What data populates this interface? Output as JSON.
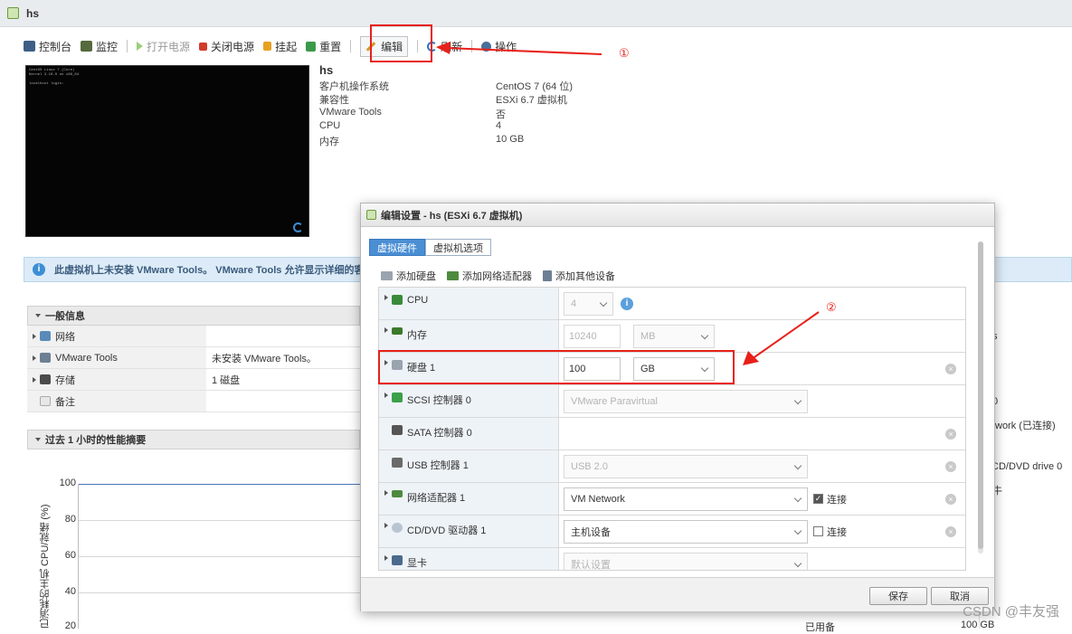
{
  "window": {
    "title": "hs"
  },
  "toolbar": {
    "console": "控制台",
    "monitor": "监控",
    "power_on": "打开电源",
    "power_off": "关闭电源",
    "suspend": "挂起",
    "reset": "重置",
    "edit": "编辑",
    "refresh": "刷新",
    "actions": "操作"
  },
  "annotations": {
    "num1": "①",
    "num2": "②"
  },
  "vm": {
    "name": "hs",
    "rows": [
      {
        "k": "客户机操作系统",
        "v": "CentOS 7 (64 位)"
      },
      {
        "k": "兼容性",
        "v": "ESXi 6.7 虚拟机"
      },
      {
        "k": "VMware Tools",
        "v": "否"
      },
      {
        "k": "CPU",
        "v": "4"
      },
      {
        "k": "内存",
        "v": "10 GB"
      }
    ]
  },
  "banner": {
    "text": "此虚拟机上未安装 VMware Tools。 VMware Tools 允许显示详细的客户"
  },
  "general": {
    "title": "一般信息",
    "rows": [
      {
        "k": "网络",
        "v": ""
      },
      {
        "k": "VMware Tools",
        "v": "未安装 VMware Tools。"
      },
      {
        "k": "存储",
        "v": "1 磁盘"
      },
      {
        "k": "备注",
        "v": ""
      }
    ]
  },
  "perf": {
    "title": "过去 1 小时的性能摘要",
    "ylabel": "已消耗的主机 CPU/就绪 (%)",
    "ticks": [
      "100",
      "80",
      "60",
      "40",
      "20"
    ]
  },
  "right_bits": [
    "s",
    "0",
    "work (已连接)",
    "CD/DVD drive 0",
    "牛",
    "已用备",
    "100 GB"
  ],
  "dialog": {
    "title": "编辑设置 - hs (ESXi 6.7 虚拟机)",
    "tabs": [
      "虚拟硬件",
      "虚拟机选项"
    ],
    "add": {
      "disk": "添加硬盘",
      "nic": "添加网络适配器",
      "other": "添加其他设备"
    },
    "hw": {
      "cpu": {
        "label": "CPU",
        "value": "4"
      },
      "mem": {
        "label": "内存",
        "value": "10240",
        "unit": "MB"
      },
      "disk": {
        "label": "硬盘 1",
        "value": "100",
        "unit": "GB"
      },
      "scsi": {
        "label": "SCSI 控制器 0",
        "value": "VMware Paravirtual"
      },
      "sata": {
        "label": "SATA 控制器 0"
      },
      "usb": {
        "label": "USB 控制器 1",
        "value": "USB 2.0"
      },
      "net": {
        "label": "网络适配器 1",
        "value": "VM Network",
        "connect": "连接"
      },
      "cd": {
        "label": "CD/DVD 驱动器 1",
        "value": "主机设备",
        "connect": "连接"
      },
      "video": {
        "label": "显卡",
        "value": "默认设置"
      }
    },
    "save": "保存",
    "cancel": "取消"
  },
  "watermark": "CSDN @丰友强"
}
